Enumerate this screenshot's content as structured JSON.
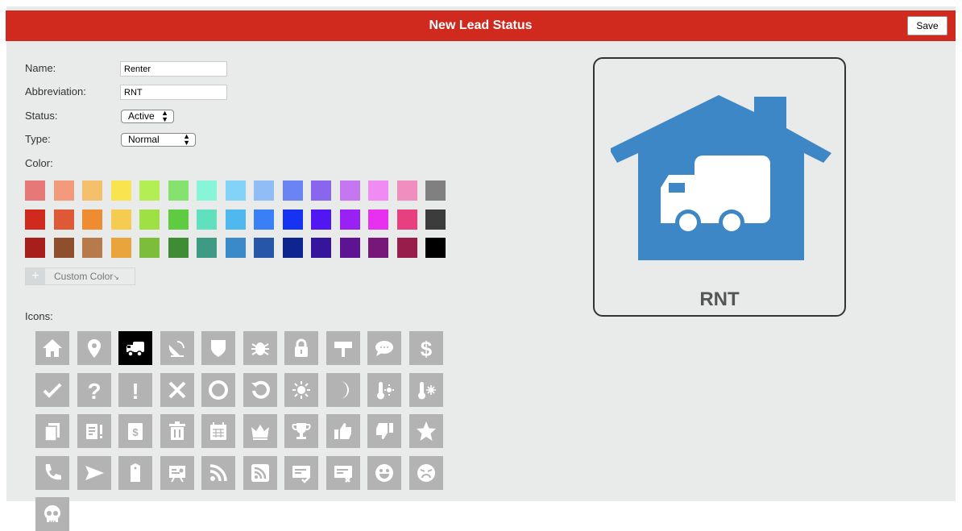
{
  "header": {
    "title": "New Lead Status",
    "save_label": "Save"
  },
  "form": {
    "name_label": "Name:",
    "name_value": "Renter",
    "abbr_label": "Abbreviation:",
    "abbr_value": "RNT",
    "status_label": "Status:",
    "status_value": "Active",
    "type_label": "Type:",
    "type_value": "Normal",
    "color_label": "Color:",
    "custom_color_label": "Custom Color",
    "custom_color_plus": "+",
    "icons_label": "Icons:"
  },
  "colors": [
    [
      "#e77878",
      "#f29a7b",
      "#f5c06b",
      "#f9e34e",
      "#b3ee54",
      "#85e26e",
      "#88f5d6",
      "#83d3f8",
      "#91bdf7",
      "#6b84f4",
      "#8a65ee",
      "#c477f1",
      "#f18bf4",
      "#f08fbf",
      "#808080"
    ],
    [
      "#d0291e",
      "#de5a36",
      "#ef8c32",
      "#f5cc50",
      "#9fe044",
      "#5ecb40",
      "#60e0bc",
      "#4fb8ef",
      "#397ff5",
      "#1733f2",
      "#5017f3",
      "#9a21f4",
      "#e830f0",
      "#e83f80",
      "#3c3c3c"
    ],
    [
      "#a81e1a",
      "#8f4f2d",
      "#b77a4b",
      "#e9a53c",
      "#7cbd3b",
      "#3e8c34",
      "#3d9b83",
      "#3a89c9",
      "#2656a8",
      "#0e248f",
      "#35159b",
      "#5c1493",
      "#78177a",
      "#991d4b",
      "#000000"
    ]
  ],
  "icons": [
    "home-icon",
    "location-pin-icon",
    "truck-icon",
    "satellite-dish-icon",
    "shield-icon",
    "bug-icon",
    "lock-icon",
    "sign-icon",
    "chat-bubble-icon",
    "dollar-icon",
    "check-icon",
    "question-icon",
    "exclamation-icon",
    "x-icon",
    "circle-icon",
    "refresh-icon",
    "sun-icon",
    "moon-icon",
    "thermometer-hot-icon",
    "thermometer-cold-icon",
    "documents-icon",
    "document-alert-icon",
    "invoice-icon",
    "trash-icon",
    "calendar-icon",
    "crown-icon",
    "trophy-icon",
    "thumbs-up-icon",
    "thumbs-down-icon",
    "star-icon",
    "phone-icon",
    "send-icon",
    "tag-icon",
    "presentation-icon",
    "rss-icon",
    "rss-box-icon",
    "card-check-icon",
    "card-x-icon",
    "smile-icon",
    "angry-face-icon",
    "skull-icon"
  ],
  "selected_icon": "truck-icon",
  "preview": {
    "abbr": "RNT",
    "icon": "house-truck-icon",
    "house_color": "#3d87c6"
  }
}
